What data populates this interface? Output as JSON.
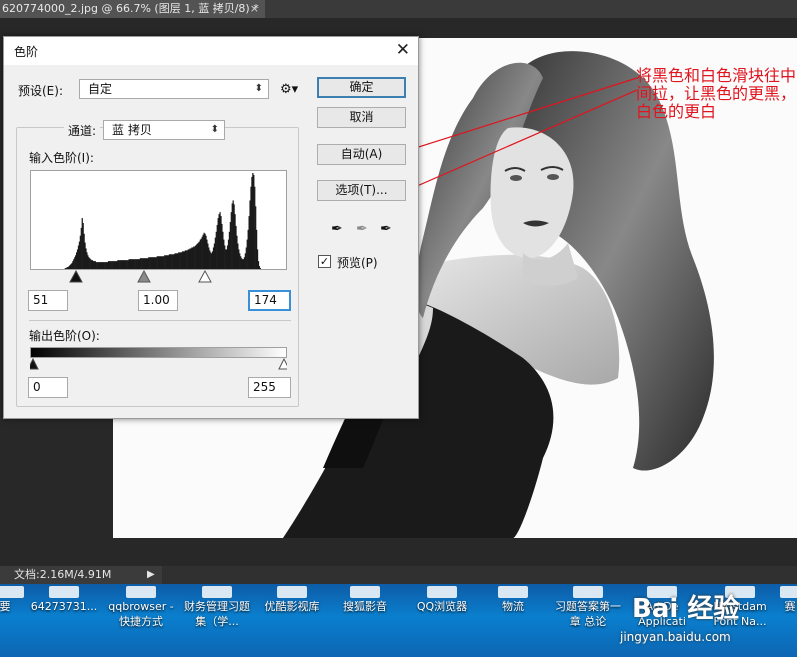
{
  "document_tab": {
    "title": "620774000_2.jpg @ 66.7% (图层 1, 蓝 拷贝/8) *",
    "close": "×"
  },
  "dialog": {
    "title": "色阶",
    "close": "✕",
    "preset_label": "预设(E):",
    "preset_value": "自定",
    "channel_label": "通道:",
    "channel_value": "蓝 拷贝",
    "input_levels_label": "输入色阶(I):",
    "input_black": "51",
    "input_gamma": "1.00",
    "input_white": "174",
    "output_levels_label": "输出色阶(O):",
    "output_black": "0",
    "output_white": "255",
    "buttons": {
      "ok": "确定",
      "cancel": "取消",
      "auto": "自动(A)",
      "options": "选项(T)..."
    },
    "preview_label": "预览(P)",
    "preview_checked": true
  },
  "annotation": {
    "text": "将黑色和白色滑块往中间拉，让黑色的更黑，白色的更白",
    "color": "#e0141e"
  },
  "status_bar": {
    "doc_info": "文档:2.16M/4.91M"
  },
  "desktop": {
    "items": [
      {
        "label": "要"
      },
      {
        "label": "64273731..."
      },
      {
        "label": "qqbrowser - 快捷方式"
      },
      {
        "label": "财务管理习题集（学..."
      },
      {
        "label": "优酷影视库"
      },
      {
        "label": "搜狐影音"
      },
      {
        "label": "QQ浏览器"
      },
      {
        "label": "物流"
      },
      {
        "label": "习题答案第一章 总论"
      },
      {
        "label": "Ad De Applicati"
      },
      {
        "label": "Hiristdam Font Na..."
      },
      {
        "label": "赛"
      }
    ]
  },
  "watermark": {
    "logo": "Bai 经验",
    "url": "jingyan.baidu.com"
  },
  "histogram": {
    "bins": [
      0,
      0,
      0,
      0,
      0,
      0,
      0,
      0,
      0,
      0,
      0,
      0,
      0,
      0,
      0,
      0,
      0,
      0,
      0,
      0,
      0,
      0,
      0,
      0,
      0,
      0,
      0,
      0,
      0,
      0,
      0,
      0,
      0,
      0,
      0,
      0,
      1,
      1,
      2,
      2,
      3,
      4,
      5,
      6,
      8,
      10,
      12,
      14,
      17,
      20,
      24,
      28,
      34,
      42,
      52,
      47,
      36,
      27,
      21,
      17,
      14,
      12,
      11,
      10,
      9,
      9,
      8,
      8,
      8,
      7,
      7,
      7,
      7,
      7,
      7,
      7,
      7,
      7,
      7,
      7,
      7,
      7,
      8,
      8,
      8,
      8,
      8,
      8,
      8,
      8,
      8,
      8,
      9,
      9,
      9,
      9,
      9,
      9,
      9,
      9,
      9,
      9,
      9,
      9,
      10,
      10,
      10,
      10,
      10,
      10,
      10,
      10,
      10,
      10,
      10,
      10,
      11,
      11,
      11,
      11,
      11,
      11,
      11,
      11,
      11,
      12,
      12,
      12,
      12,
      12,
      12,
      12,
      12,
      12,
      13,
      13,
      13,
      13,
      13,
      13,
      13,
      13,
      14,
      14,
      14,
      14,
      14,
      15,
      15,
      15,
      15,
      15,
      15,
      16,
      16,
      16,
      16,
      17,
      17,
      17,
      17,
      18,
      18,
      18,
      19,
      19,
      19,
      20,
      20,
      21,
      21,
      22,
      22,
      23,
      23,
      24,
      25,
      26,
      27,
      28,
      30,
      31,
      33,
      35,
      37,
      36,
      34,
      30,
      26,
      22,
      19,
      17,
      16,
      18,
      22,
      26,
      32,
      38,
      45,
      52,
      56,
      58,
      54,
      46,
      38,
      30,
      24,
      20,
      20,
      24,
      30,
      38,
      48,
      58,
      67,
      70,
      66,
      56,
      44,
      34,
      26,
      20,
      16,
      13,
      11,
      10,
      10,
      12,
      16,
      22,
      30,
      40,
      54,
      70,
      84,
      94,
      98,
      96,
      84,
      64,
      40,
      20,
      8,
      3,
      1,
      0,
      0,
      0,
      0,
      0,
      0,
      0,
      0,
      0,
      0,
      0,
      0,
      0,
      0,
      0,
      0,
      0,
      0,
      0,
      0,
      0,
      0,
      0,
      0,
      0,
      0,
      0
    ]
  }
}
